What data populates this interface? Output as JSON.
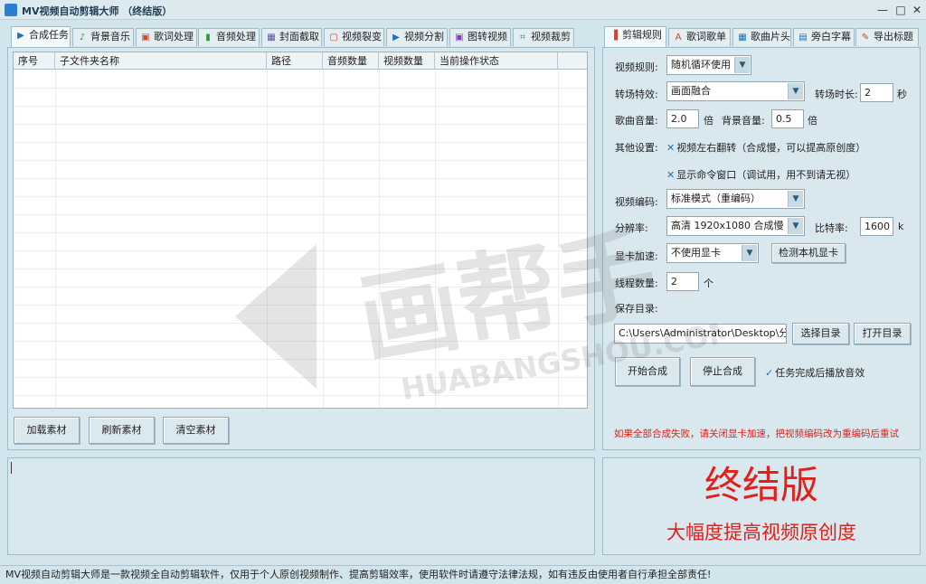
{
  "window": {
    "title": "MV视频自动剪辑大师 （终结版）",
    "minimize": "—",
    "maximize": "□",
    "close": "✕"
  },
  "left_tabs": [
    {
      "label": "合成任务",
      "icon": "play-icon",
      "glyph": "▶",
      "color": "#1f6fb5"
    },
    {
      "label": "背景音乐",
      "icon": "music-note-icon",
      "glyph": "♪",
      "color": "#2e9b3a"
    },
    {
      "label": "歌词处理",
      "icon": "lyrics-icon",
      "glyph": "▣",
      "color": "#d9412b"
    },
    {
      "label": "音频处理",
      "icon": "waveform-icon",
      "glyph": "▮",
      "color": "#2e9b3a"
    },
    {
      "label": "封面截取",
      "icon": "image-icon",
      "glyph": "▦",
      "color": "#5a4ea0"
    },
    {
      "label": "视频裂变",
      "icon": "split-icon",
      "glyph": "▢",
      "color": "#d9412b"
    },
    {
      "label": "视频分割",
      "icon": "video-icon",
      "glyph": "▶",
      "color": "#1f6fb5"
    },
    {
      "label": "图转视频",
      "icon": "picture-video-icon",
      "glyph": "▣",
      "color": "#8a3ab9"
    },
    {
      "label": "视频裁剪",
      "icon": "crop-icon",
      "glyph": "⌗",
      "color": "#2e9b3a"
    }
  ],
  "task_table": {
    "columns": [
      "序号",
      "子文件夹名称",
      "路径",
      "音频数量",
      "视频数量",
      "当前操作状态"
    ],
    "rows": []
  },
  "left_buttons": {
    "load": "加载素材",
    "refresh": "刷新素材",
    "clear": "清空素材"
  },
  "right_tabs": [
    {
      "label": "剪辑规则",
      "icon": "film-icon",
      "glyph": "▐",
      "color": "#d9412b"
    },
    {
      "label": "歌词歌单",
      "icon": "font-icon",
      "glyph": "A",
      "color": "#d9412b"
    },
    {
      "label": "歌曲片头",
      "icon": "image-icon",
      "glyph": "▦",
      "color": "#1f6fb5"
    },
    {
      "label": "旁白字幕",
      "icon": "document-icon",
      "glyph": "▤",
      "color": "#1f6fb5"
    },
    {
      "label": "导出标题",
      "icon": "export-icon",
      "glyph": "✎",
      "color": "#d9412b"
    }
  ],
  "settings": {
    "video_rule_label": "视频规则:",
    "video_rule_value": "随机循环使用",
    "transition_label": "转场特效:",
    "transition_value": "画面融合",
    "transition_duration_label": "转场时长:",
    "transition_duration_value": "2",
    "transition_duration_unit": "秒",
    "song_volume_label": "歌曲音量:",
    "song_volume_value": "2.0",
    "song_volume_unit": "倍",
    "bg_volume_label": "背景音量:",
    "bg_volume_value": "0.5",
    "bg_volume_unit": "倍",
    "other_label": "其他设置:",
    "flip_option": "视频左右翻转（合成慢，可以提高原创度）",
    "cmd_option": "显示命令窗口（调试用，用不到请无视）",
    "encoding_label": "视频编码:",
    "encoding_value": "标准模式（重编码）",
    "resolution_label": "分辨率:",
    "resolution_value": "高清 1920x1080 合成慢",
    "bitrate_label": "比特率:",
    "bitrate_value": "1600",
    "bitrate_unit": "k",
    "gpu_label": "显卡加速:",
    "gpu_value": "不使用显卡",
    "detect_gpu_button": "检测本机显卡",
    "threads_label": "线程数量:",
    "threads_value": "2",
    "threads_unit": "个",
    "save_dir_label": "保存目录:",
    "save_dir_value": "C:\\Users\\Administrator\\Desktop\\分享",
    "choose_dir_button": "选择目录",
    "open_dir_button": "打开目录",
    "start_button": "开始合成",
    "stop_button": "停止合成",
    "play_sound_option": "任务完成后播放音效",
    "warning": "如果全部合成失败，请关闭显卡加速，把视频编码改为重编码后重试"
  },
  "promo": {
    "title": "终结版",
    "subtitle": "大幅度提高视频原创度",
    "color": "#e0201a"
  },
  "watermark": {
    "logo_text": "画帮手",
    "url_text": "HUABANGSHOU.COM"
  },
  "status_bar": "MV视频自动剪辑大师是一款视频全自动剪辑软件，仅用于个人原创视频制作、提高剪辑效率，使用软件时请遵守法律法规，如有违反由使用者自行承担全部责任!"
}
